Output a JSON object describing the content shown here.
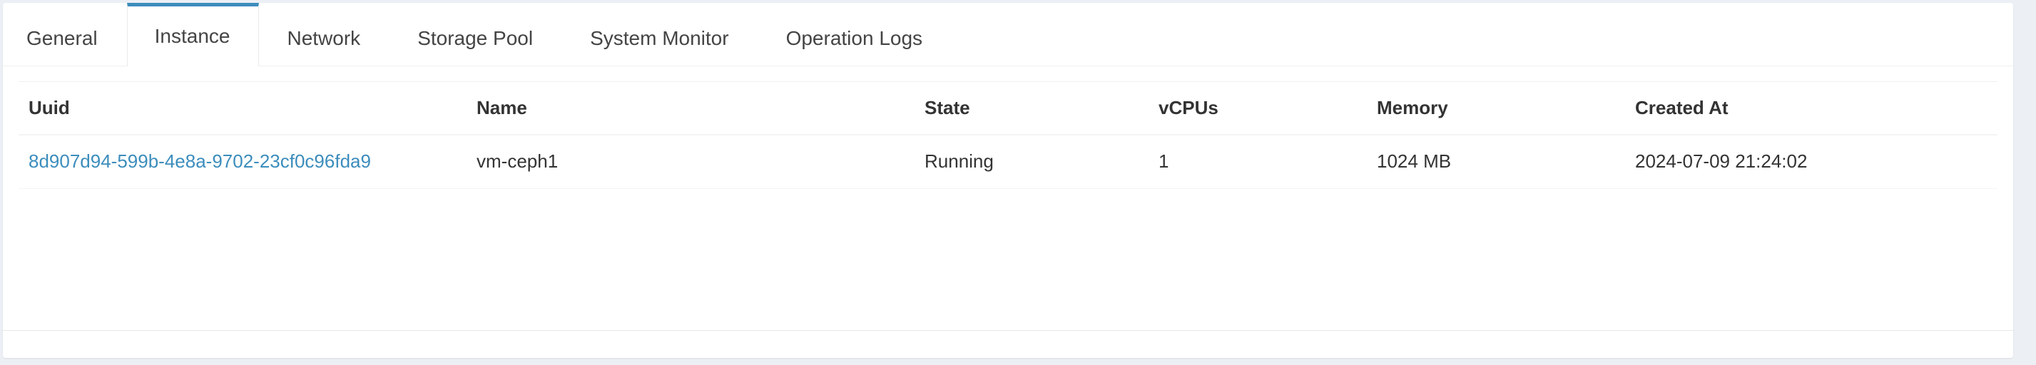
{
  "tabs": [
    {
      "label": "General",
      "active": false
    },
    {
      "label": "Instance",
      "active": true
    },
    {
      "label": "Network",
      "active": false
    },
    {
      "label": "Storage Pool",
      "active": false
    },
    {
      "label": "System Monitor",
      "active": false
    },
    {
      "label": "Operation Logs",
      "active": false
    }
  ],
  "table": {
    "headers": {
      "uuid": "Uuid",
      "name": "Name",
      "state": "State",
      "vcpus": "vCPUs",
      "memory": "Memory",
      "created_at": "Created At"
    },
    "rows": [
      {
        "uuid": "8d907d94-599b-4e8a-9702-23cf0c96fda9",
        "name": "vm-ceph1",
        "state": "Running",
        "vcpus": "1",
        "memory": "1024 MB",
        "created_at": "2024-07-09 21:24:02"
      }
    ]
  },
  "colors": {
    "accent": "#3c8dbc",
    "background": "#ecf0f5",
    "panel": "#ffffff"
  }
}
